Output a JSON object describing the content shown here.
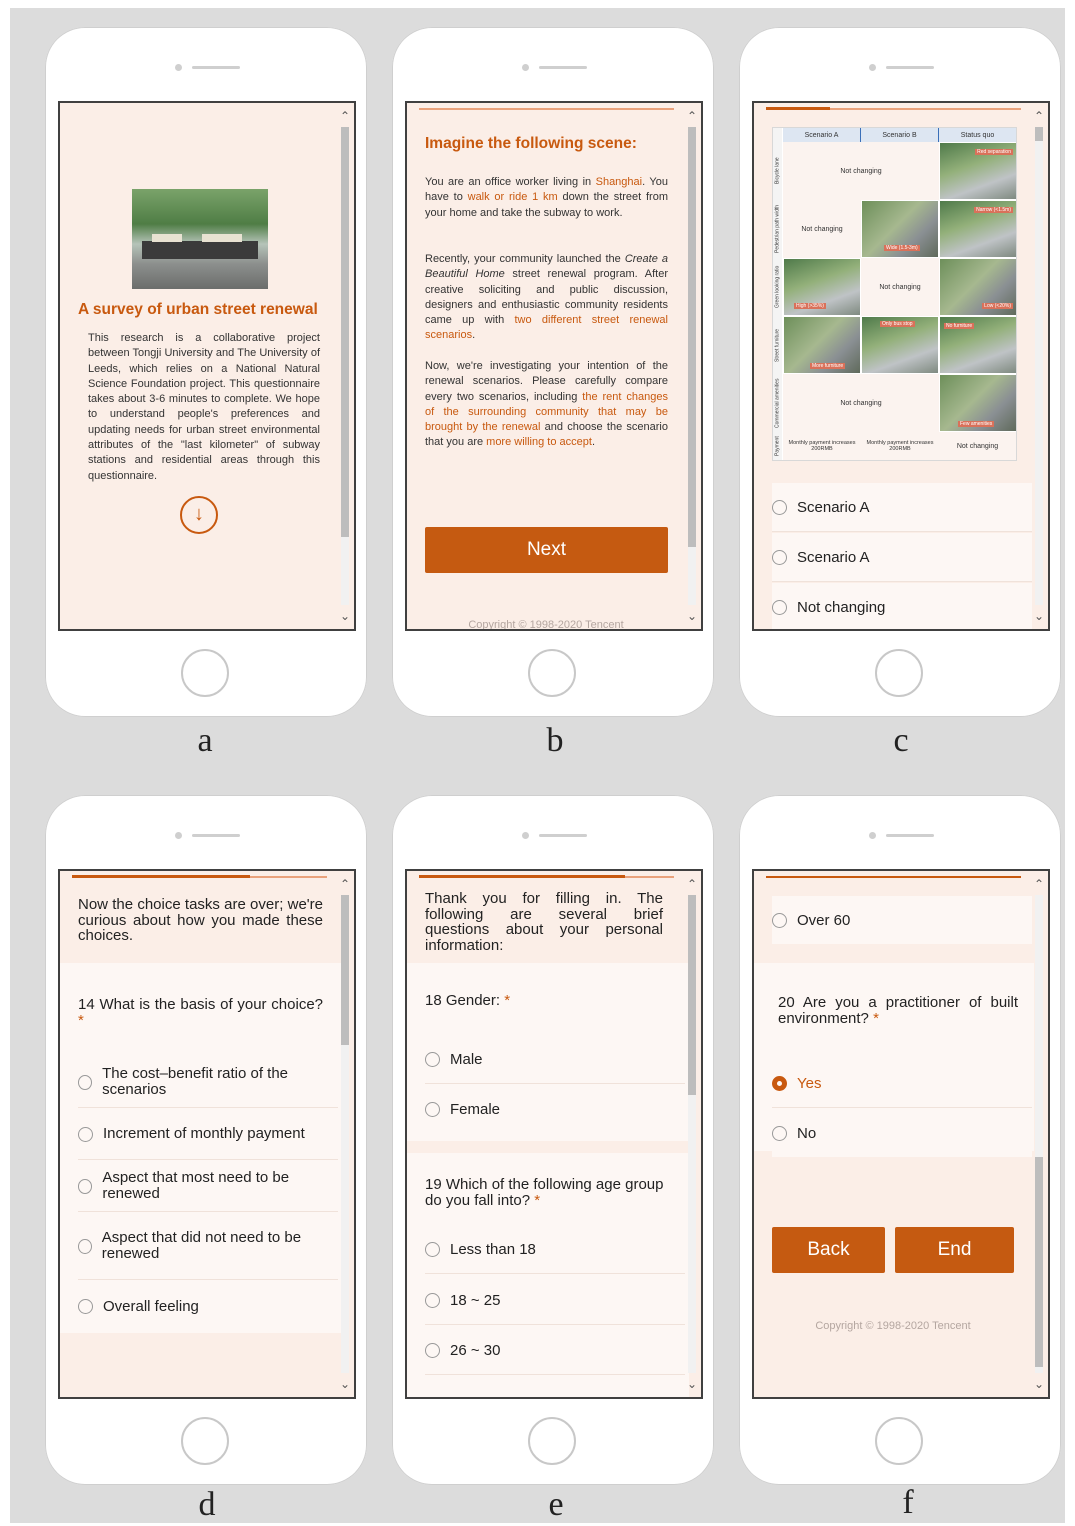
{
  "panel_labels": [
    "a",
    "b",
    "c",
    "d",
    "e",
    "f"
  ],
  "panel_a": {
    "title": "A survey of urban street renewal",
    "body": "This research is a collaborative project between Tongji University and The University of Leeds, which relies on a National Natural Science Foundation project. This questionnaire takes about 3-6 minutes to complete. We hope to understand people's preferences and updating needs for urban street environmental attributes of the \"last kilometer\" of subway stations and residential areas through this questionnaire."
  },
  "panel_b": {
    "heading": "Imagine the following scene:",
    "p1": [
      "You are an office worker living in ",
      "Shanghai",
      ". You have to ",
      "walk or ride 1 km",
      " down the street from your home and take the subway to work."
    ],
    "p2": [
      "Recently, your community launched the ",
      "Create a Beautiful Home",
      " street renewal program. After creative soliciting and public discussion, designers and enthusiastic community residents came up with ",
      "two different street renewal scenarios",
      "."
    ],
    "p3": [
      "Now, we're investigating your intention of the renewal scenarios. Please carefully compare every two scenarios, including ",
      "the rent changes of the surrounding community that may be brought by the renewal",
      " and choose the scenario that you are ",
      "more willing to accept",
      "."
    ],
    "next": "Next",
    "copyright": "Copyright © 1998-2020 Tencent"
  },
  "panel_c": {
    "columns": [
      "Scenario A",
      "Scenario B",
      "Status quo"
    ],
    "rows": [
      "Bicycle lane",
      "Pedestrian path width",
      "Green looking ratio",
      "Street furniture",
      "Commercial amenities",
      "Payment"
    ],
    "not_changing": "Not changing",
    "payment_a": "Monthly payment increases 200RMB",
    "payment_b": "Monthly payment increases 200RMB",
    "tags": [
      "Red separation",
      "Narrow (<1.5m)",
      "Wide (1.5-3m)",
      "High (>35%)",
      "Low (<20%)",
      "Only bus stop",
      "More furniture",
      "No furniture",
      "Few amenities"
    ],
    "options": [
      "Scenario A",
      "Scenario A",
      "Not changing"
    ]
  },
  "panel_d": {
    "intro": "Now the choice tasks are over; we're curious about how you made these choices.",
    "question_num": "14",
    "question": "What is the basis of your choice?",
    "required": "*",
    "options": [
      "The cost–benefit ratio of the scenarios",
      "Increment of monthly payment",
      "Aspect that most need to be renewed",
      "Aspect that did not need to be renewed",
      "Overall feeling"
    ]
  },
  "panel_e": {
    "intro": "Thank you for filling in. The following are several brief questions about your personal information:",
    "q18": "18 Gender:",
    "q18_options": [
      "Male",
      "Female"
    ],
    "q19": "19 Which of the following age group do you fall into?",
    "q19_options": [
      "Less than 18",
      "18 ~ 25",
      "26 ~ 30"
    ],
    "required": "*"
  },
  "panel_f": {
    "top_option": "Over 60",
    "q20": "20 Are you a practitioner of built environment?",
    "required": "*",
    "options": [
      "Yes",
      "No"
    ],
    "selected": "Yes",
    "back": "Back",
    "end": "End",
    "copyright": "Copyright © 1998-2020 Tencent"
  },
  "accent_color": "#c8590f"
}
